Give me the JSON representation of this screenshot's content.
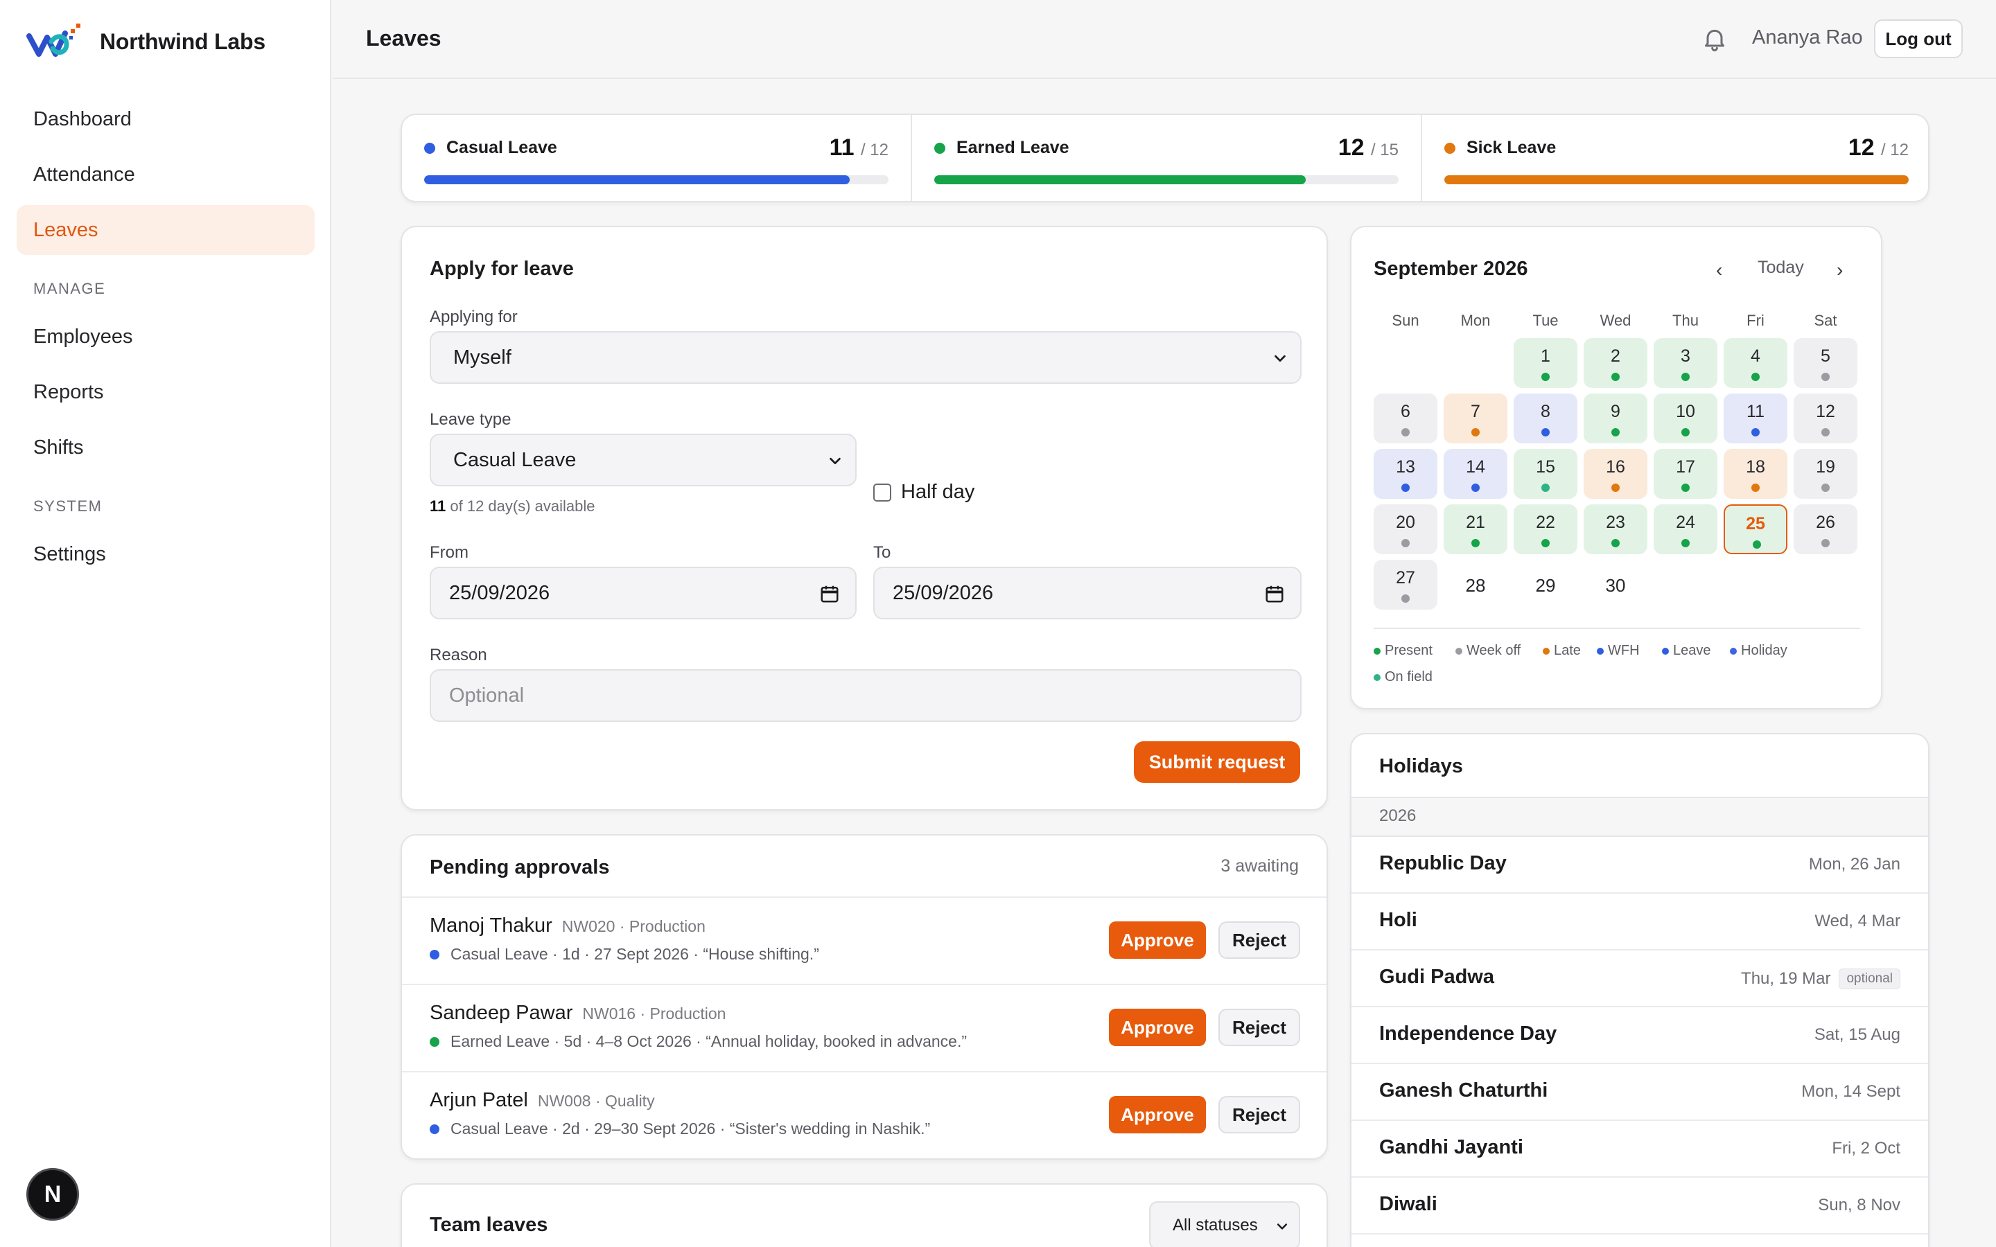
{
  "app": {
    "brand_name": "Northwind Labs",
    "accent_color": "#e85a0c"
  },
  "sidebar": {
    "items": [
      {
        "label": "Dashboard",
        "icon": ""
      },
      {
        "label": "Attendance"
      },
      {
        "label": "Leaves",
        "active": true
      }
    ],
    "manage_heading": "MANAGE",
    "manage_items": [
      {
        "label": "Employees"
      },
      {
        "label": "Reports"
      },
      {
        "label": "Shifts"
      }
    ],
    "system_heading": "SYSTEM",
    "system_items": [
      {
        "label": "Settings"
      }
    ],
    "help_fab_letter": "N"
  },
  "header": {
    "title": "Leaves",
    "bell_icon": "bell-icon",
    "user_name": "Ananya Rao",
    "logout_label": "Log out"
  },
  "balances": [
    {
      "label": "Casual Leave",
      "used": "11",
      "total": "/ 12",
      "fraction": 0.9167,
      "color": "#2f5fe0"
    },
    {
      "label": "Earned Leave",
      "used": "12",
      "total": "/ 15",
      "fraction": 0.8,
      "color": "#16a34a"
    },
    {
      "label": "Sick Leave",
      "used": "12",
      "total": "/ 12",
      "fraction": 1.0,
      "color": "#e0780e"
    }
  ],
  "apply_form": {
    "title": "Apply for leave",
    "applying_for_label": "Applying for",
    "applying_for_value": "Myself",
    "leave_type_label": "Leave type",
    "leave_type_value": "Casual Leave",
    "available_count": "11",
    "available_text": "of 12 day(s) available",
    "half_day_label": "Half day",
    "half_day_checked": false,
    "from_label": "From",
    "from_value": "25/09/2026",
    "to_label": "To",
    "to_value": "25/09/2026",
    "reason_label": "Reason",
    "reason_placeholder": "Optional",
    "submit_label": "Submit request"
  },
  "pending": {
    "title": "Pending approvals",
    "awaiting_text": "3 awaiting",
    "approve_label": "Approve",
    "reject_label": "Reject",
    "requests": [
      {
        "name": "Manoj Thakur",
        "meta": "NW020 · Production",
        "detail": "Casual Leave · 1d · 27 Sept 2026 · “House shifting.”",
        "color": "#2f5fe0"
      },
      {
        "name": "Sandeep Pawar",
        "meta": "NW016 · Production",
        "detail": "Earned Leave · 5d · 4–8 Oct 2026 · “Annual holiday, booked in advance.”",
        "color": "#16a34a"
      },
      {
        "name": "Arjun Patel",
        "meta": "NW008 · Quality",
        "detail": "Casual Leave · 2d · 29–30 Sept 2026 · “Sister's wedding in Nashik.”",
        "color": "#2f5fe0"
      }
    ]
  },
  "team_leaves": {
    "title": "Team leaves",
    "status_filter": "All statuses"
  },
  "calendar": {
    "title": "September 2026",
    "today_label": "Today",
    "prev_glyph": "‹",
    "next_glyph": "›",
    "weekdays": [
      "Sun",
      "Mon",
      "Tue",
      "Wed",
      "Thu",
      "Fri",
      "Sat"
    ],
    "first_weekday_index": 2,
    "status_colors": {
      "present": {
        "bg": "#e2f3e6",
        "dot": "#16a34a"
      },
      "weekoff": {
        "bg": "#efeff1",
        "dot": "#9b9ba1"
      },
      "late": {
        "bg": "#fbe9da",
        "dot": "#e0780e"
      },
      "wfh": {
        "bg": "#e5e8f8",
        "dot": "#2f5fe0"
      },
      "field": {
        "bg": "#e2f3e6",
        "dot": "#2fb384"
      },
      "none": {
        "bg": "transparent",
        "dot": ""
      }
    },
    "days": [
      {
        "d": "1",
        "s": "present"
      },
      {
        "d": "2",
        "s": "present"
      },
      {
        "d": "3",
        "s": "present"
      },
      {
        "d": "4",
        "s": "present"
      },
      {
        "d": "5",
        "s": "weekoff"
      },
      {
        "d": "6",
        "s": "weekoff"
      },
      {
        "d": "7",
        "s": "late"
      },
      {
        "d": "8",
        "s": "wfh"
      },
      {
        "d": "9",
        "s": "present"
      },
      {
        "d": "10",
        "s": "present"
      },
      {
        "d": "11",
        "s": "wfh"
      },
      {
        "d": "12",
        "s": "weekoff"
      },
      {
        "d": "13",
        "s": "wfh"
      },
      {
        "d": "14",
        "s": "wfh"
      },
      {
        "d": "15",
        "s": "field"
      },
      {
        "d": "16",
        "s": "late"
      },
      {
        "d": "17",
        "s": "present"
      },
      {
        "d": "18",
        "s": "late"
      },
      {
        "d": "19",
        "s": "weekoff"
      },
      {
        "d": "20",
        "s": "weekoff"
      },
      {
        "d": "21",
        "s": "present"
      },
      {
        "d": "22",
        "s": "present"
      },
      {
        "d": "23",
        "s": "present"
      },
      {
        "d": "24",
        "s": "present"
      },
      {
        "d": "25",
        "s": "present",
        "today": true
      },
      {
        "d": "26",
        "s": "weekoff"
      },
      {
        "d": "27",
        "s": "weekoff"
      },
      {
        "d": "28",
        "s": "none"
      },
      {
        "d": "29",
        "s": "none"
      },
      {
        "d": "30",
        "s": "none"
      }
    ],
    "legend": [
      {
        "label": "Present",
        "color": "#16a34a"
      },
      {
        "label": "Week off",
        "color": "#9b9ba1"
      },
      {
        "label": "Late",
        "color": "#e0780e"
      },
      {
        "label": "WFH",
        "color": "#2f5fe0"
      },
      {
        "label": "Leave",
        "color": "#2f5fe0"
      },
      {
        "label": "Holiday",
        "color": "#3f63e6"
      },
      {
        "label": "On field",
        "color": "#2fb384"
      }
    ]
  },
  "holidays": {
    "title": "Holidays",
    "year": "2026",
    "items": [
      {
        "name": "Republic Day",
        "date": "Mon, 26 Jan",
        "badge": ""
      },
      {
        "name": "Holi",
        "date": "Wed, 4 Mar",
        "badge": ""
      },
      {
        "name": "Gudi Padwa",
        "date": "Thu, 19 Mar",
        "badge": "optional"
      },
      {
        "name": "Independence Day",
        "date": "Sat, 15 Aug",
        "badge": ""
      },
      {
        "name": "Ganesh Chaturthi",
        "date": "Mon, 14 Sept",
        "badge": ""
      },
      {
        "name": "Gandhi Jayanti",
        "date": "Fri, 2 Oct",
        "badge": ""
      },
      {
        "name": "Diwali",
        "date": "Sun, 8 Nov",
        "badge": ""
      }
    ]
  }
}
